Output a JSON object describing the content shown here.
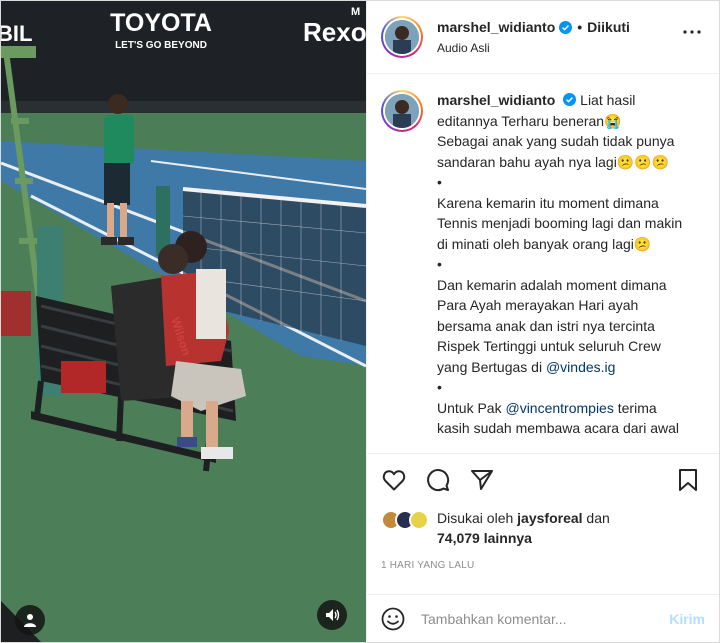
{
  "post": {
    "username": "marshel_widianto",
    "follow_label": "Diikuti",
    "separator": "•",
    "audio": "Audio Asli"
  },
  "video": {
    "banner_brand": "TOYOTA",
    "banner_tagline": "LET'S GO BEYOND",
    "banner_right": "Rexor",
    "banner_right_small": "M",
    "banner_left": "BIL",
    "bag_brand": "Wilson"
  },
  "caption": {
    "username": "marshel_widianto",
    "lines": [
      "Liat hasil editannya Terharu beneran😭",
      "Sebagai anak yang sudah tidak punya sandaran bahu ayah nya lagi😕😕😕",
      "•",
      "Karena kemarin itu moment dimana Tennis menjadi booming lagi dan makin di minati oleh banyak orang lagi😕",
      "•",
      "Dan kemarin adalah moment dimana Para Ayah merayakan Hari ayah bersama anak dan istri nya tercinta Rispek Tertinggi untuk seluruh Crew yang Bertugas di",
      "•",
      "Untuk Pak",
      "terima kasih sudah membawa acara dari awal"
    ],
    "mention1": "@vindes.ig",
    "mention2": "@vincentrompies"
  },
  "likes": {
    "prefix": "Disukai oleh",
    "user": "jaysforeal",
    "middle": "dan",
    "count": "74,079",
    "suffix": "lainnya"
  },
  "time_ago": "1 HARI YANG LALU",
  "comment_input": {
    "placeholder": "Tambahkan komentar...",
    "post_label": "Kirim"
  },
  "colors": {
    "verified": "#0095f6",
    "mention": "#00376b",
    "post_disabled": "#b2dffc",
    "court_blue": "#3f79a8",
    "court_green": "#4a7e55"
  }
}
